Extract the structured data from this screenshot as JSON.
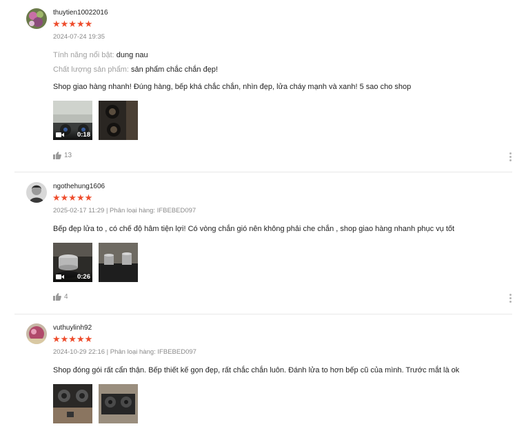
{
  "reviews": [
    {
      "username": "thuytien10022016",
      "rating": 5,
      "stars": "★★★★★",
      "meta": "2024-07-24 19:35",
      "attributes": [
        {
          "key": "Tính năng nổi bật:",
          "value": "dung nau"
        },
        {
          "key": "Chất lượng sản phẩm:",
          "value": "sản phẩm chắc chắn đẹp!"
        }
      ],
      "content": "Shop giao hàng nhanh! Đúng hàng, bếp khá chắc chắn, nhìn đẹp, lửa cháy mạnh và xanh! 5 sao cho shop",
      "video_duration": "0:18",
      "likes": "13"
    },
    {
      "username": "ngothehung1606",
      "rating": 5,
      "stars": "★★★★★",
      "meta": "2025-02-17 11:29 | Phân loại hàng: IFBEBED097",
      "content": "Bếp đẹp lửa to , có chế độ hâm tiện lợi! Có vòng chắn gió nên không phải che chắn , shop giao hàng nhanh phục vụ tốt",
      "video_duration": "0:26",
      "likes": "4"
    },
    {
      "username": "vuthuylinh92",
      "rating": 5,
      "stars": "★★★★★",
      "meta": "2024-10-29 22:16 | Phân loại hàng: IFBEBED097",
      "content": "Shop đóng gói rất cẩn thận. Bếp thiết kế gọn đẹp, rất chắc chắn luôn. Đánh lửa to hơn bếp cũ của mình. Trước mắt là ok"
    }
  ],
  "colors": {
    "star": "#ee4d2d",
    "muted": "#8a8a8a",
    "divider": "#e8e8e8"
  }
}
